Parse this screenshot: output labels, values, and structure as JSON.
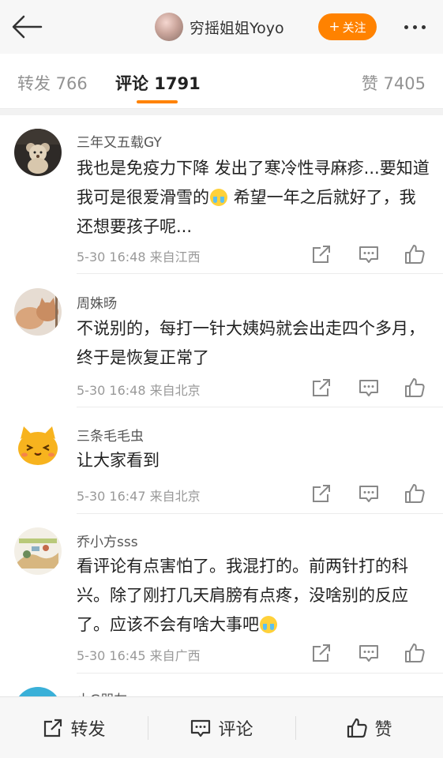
{
  "header": {
    "username": "穷摇姐姐Yoyo",
    "follow_plus": "+",
    "follow_label": "关注"
  },
  "tabs": {
    "repost": "转发 766",
    "comment": "评论 1791",
    "like": "赞 7405"
  },
  "comments": [
    {
      "user": "三年又五载GY",
      "text_a": "我也是免疫力下降 发出了寒冷性寻麻疹...要知道我可是很爱滑雪的",
      "text_b": " 希望一年之后就好了，我还想要孩子呢...",
      "meta": "5-30 16:48  来自江西"
    },
    {
      "user": "周姝旸",
      "text_a": "不说别的，每打一针大姨妈就会出走四个多月，终于是恢复正常了",
      "meta": "5-30 16:48  来自北京"
    },
    {
      "user": "三条毛毛虫",
      "text_a": "让大家看到",
      "meta": "5-30 16:47  来自北京"
    },
    {
      "user": "乔小方sss",
      "text_a": "看评论有点害怕了。我混打的。前两针打的科兴。除了刚打几天肩膀有点疼，没啥别的反应了。应该不会有啥大事吧",
      "meta": "5-30 16:45  来自广西"
    },
    {
      "user": "小G朋友"
    }
  ],
  "bottom_bar": {
    "repost": "转发",
    "comment": "评论",
    "like": "赞"
  },
  "colors": {
    "accent": "#ff8200",
    "header_bg": "#f7f7f7"
  }
}
